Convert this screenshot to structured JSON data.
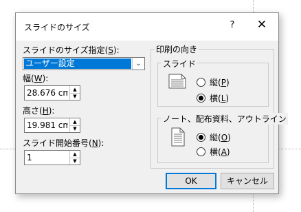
{
  "dialog": {
    "title": "スライドのサイズ",
    "help_label": "?",
    "close_label": "✕"
  },
  "slide_size": {
    "label_prefix": "スライドのサイズ指定(",
    "label_key": "S",
    "label_suffix": "):",
    "value": "ユーザー設定"
  },
  "width": {
    "label_prefix": "幅(",
    "label_key": "W",
    "label_suffix": "):",
    "value": "28.676 cm"
  },
  "height": {
    "label_prefix": "高さ(",
    "label_key": "H",
    "label_suffix": "):",
    "value": "19.981 cm"
  },
  "start_number": {
    "label_prefix": "スライド開始番号(",
    "label_key": "N",
    "label_suffix": "):",
    "value": "1"
  },
  "orientation": {
    "group_title": "印刷の向き",
    "slides": {
      "title": "スライド",
      "portrait_prefix": "縦(",
      "portrait_key": "P",
      "portrait_suffix": ")",
      "landscape_prefix": "横(",
      "landscape_key": "L",
      "landscape_suffix": ")",
      "selected": "landscape"
    },
    "notes": {
      "title": "ノート、配布資料、アウトライン",
      "portrait_prefix": "縦(",
      "portrait_key": "O",
      "portrait_suffix": ")",
      "landscape_prefix": "横(",
      "landscape_key": "A",
      "landscape_suffix": ")",
      "selected": "portrait"
    }
  },
  "buttons": {
    "ok": "OK",
    "cancel": "キャンセル"
  },
  "colors": {
    "selection": "#0078d7",
    "dialog_bg": "#f0f0f0"
  }
}
